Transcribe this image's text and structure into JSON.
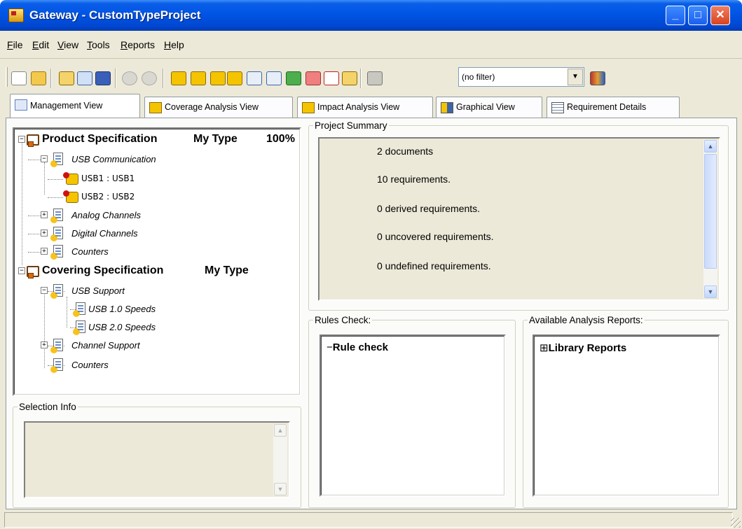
{
  "window": {
    "title": "Gateway - CustomTypeProject"
  },
  "menu": [
    "File",
    "Edit",
    "View",
    "Tools",
    "Reports",
    "Help"
  ],
  "toolbar": {
    "filter_value": "(no filter)",
    "icons": [
      "new-project-icon",
      "open-project-icon",
      "import-document-icon",
      "search-document-icon",
      "save-icon",
      "back-icon",
      "forward-icon",
      "coverage-icon",
      "impact-icon",
      "undefined-requirements-icon",
      "uncovered-requirements-icon",
      "upstream-icon",
      "downstream-icon",
      "compare-icon",
      "link-icon",
      "delete-icon",
      "export-icon",
      "settings-tools-icon",
      "apply-filter-icon"
    ]
  },
  "tabs": [
    {
      "label": "Management View",
      "active": true
    },
    {
      "label": "Coverage Analysis View"
    },
    {
      "label": "Impact Analysis View"
    },
    {
      "label": "Graphical View"
    },
    {
      "label": "Requirement Details"
    }
  ],
  "tree": {
    "product": {
      "name": "Product Specification",
      "type": "My Type",
      "coverage": "100%"
    },
    "usb_comm": "USB Communication",
    "usb1": "USB1 : USB1",
    "usb2": "USB2 : USB2",
    "analog": "Analog Channels",
    "digital": "Digital Channels",
    "counters1": "Counters",
    "covering": {
      "name": "Covering Specification",
      "type": "My Type"
    },
    "usb_support": "USB Support",
    "usb10": "USB 1.0 Speeds",
    "usb20": "USB 2.0 Speeds",
    "channel_support": "Channel Support",
    "counters2": "Counters"
  },
  "project_summary": {
    "legend": "Project Summary",
    "lines": [
      "2 documents",
      "10 requirements.",
      "0 derived requirements.",
      "0 uncovered requirements.",
      "0 undefined requirements."
    ]
  },
  "selection_info": {
    "legend": "Selection Info"
  },
  "rules_check": {
    "legend": "Rules Check:",
    "root": "Rule check"
  },
  "reports": {
    "legend": "Available Analysis Reports:",
    "root": "Library Reports"
  }
}
